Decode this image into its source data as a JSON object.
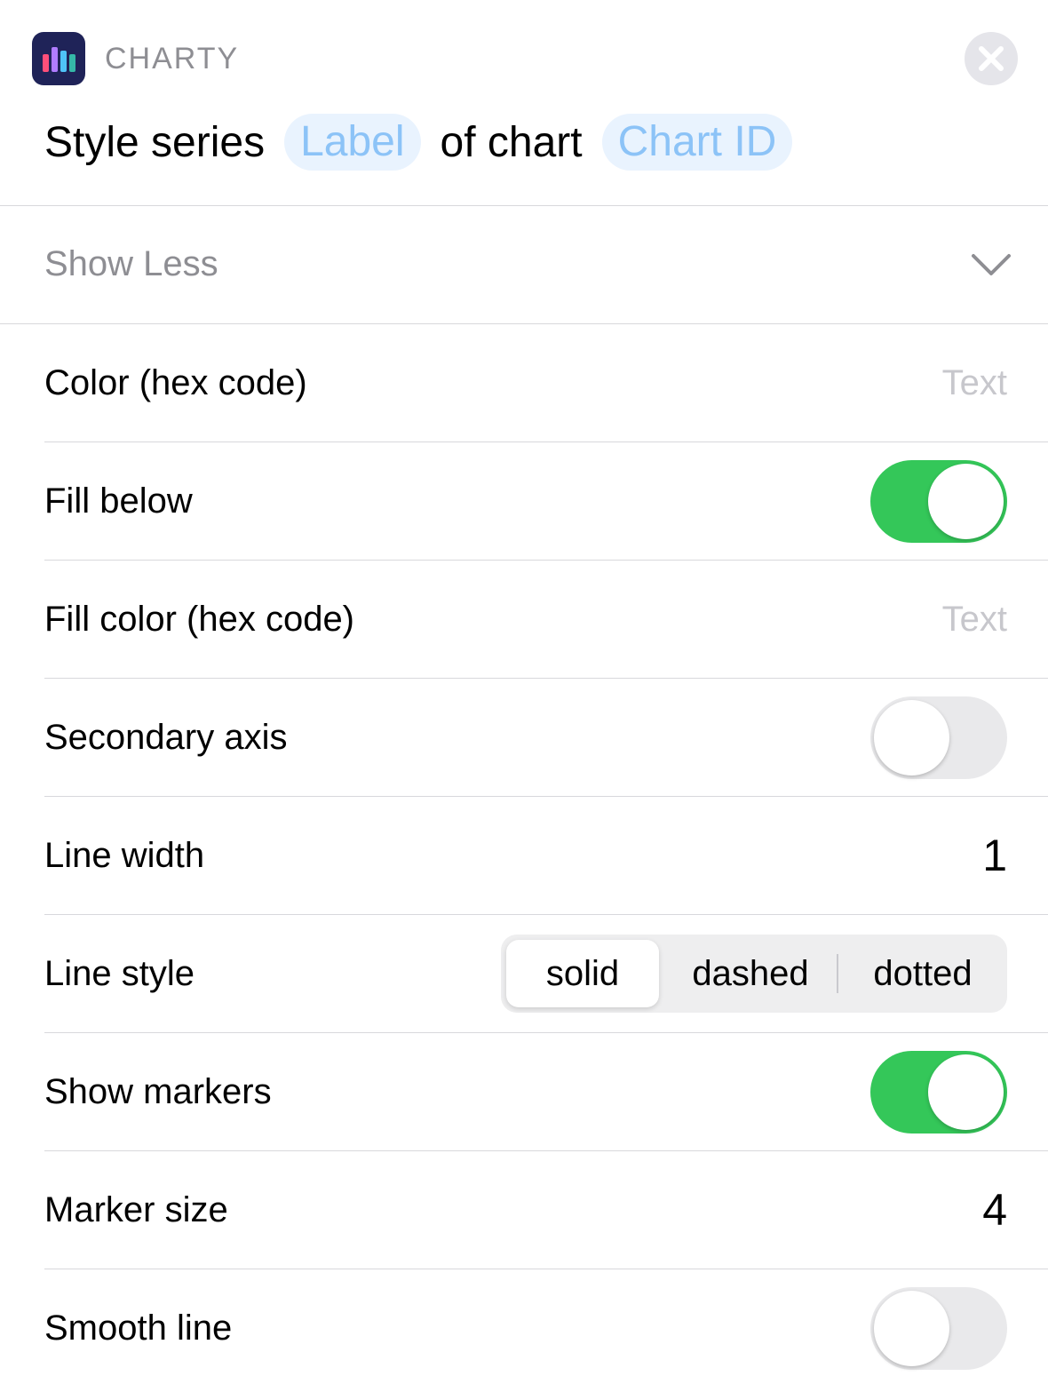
{
  "app": {
    "name": "CHARTY",
    "icon": "bar-chart-icon",
    "icon_colors": [
      "#ff4f7a",
      "#b07cff",
      "#4fc3f7",
      "#35b8a8"
    ]
  },
  "header": {
    "title_part1": "Style series",
    "token_label": "Label",
    "title_part2": "of chart",
    "token_chart_id": "Chart ID",
    "close_icon": "close-icon"
  },
  "show_less": {
    "label": "Show Less",
    "icon": "chevron-down-icon"
  },
  "fields": {
    "color": {
      "label": "Color (hex code)",
      "placeholder": "Text"
    },
    "fill_below": {
      "label": "Fill below",
      "on": true
    },
    "fill_color": {
      "label": "Fill color (hex code)",
      "placeholder": "Text"
    },
    "secondary_axis": {
      "label": "Secondary axis",
      "on": false
    },
    "line_width": {
      "label": "Line width",
      "value": "1"
    },
    "line_style": {
      "label": "Line style",
      "options": [
        "solid",
        "dashed",
        "dotted"
      ],
      "selected": "solid"
    },
    "show_markers": {
      "label": "Show markers",
      "on": true
    },
    "marker_size": {
      "label": "Marker size",
      "value": "4"
    },
    "smooth_line": {
      "label": "Smooth line",
      "on": false
    }
  },
  "colors": {
    "toggle_on": "#34c759",
    "toggle_off": "#e9e9eb",
    "token_text": "#8cc3f7",
    "token_bg": "#e9f3fe",
    "secondary_text": "#8e8e93",
    "placeholder_text": "#c7c7cc"
  }
}
